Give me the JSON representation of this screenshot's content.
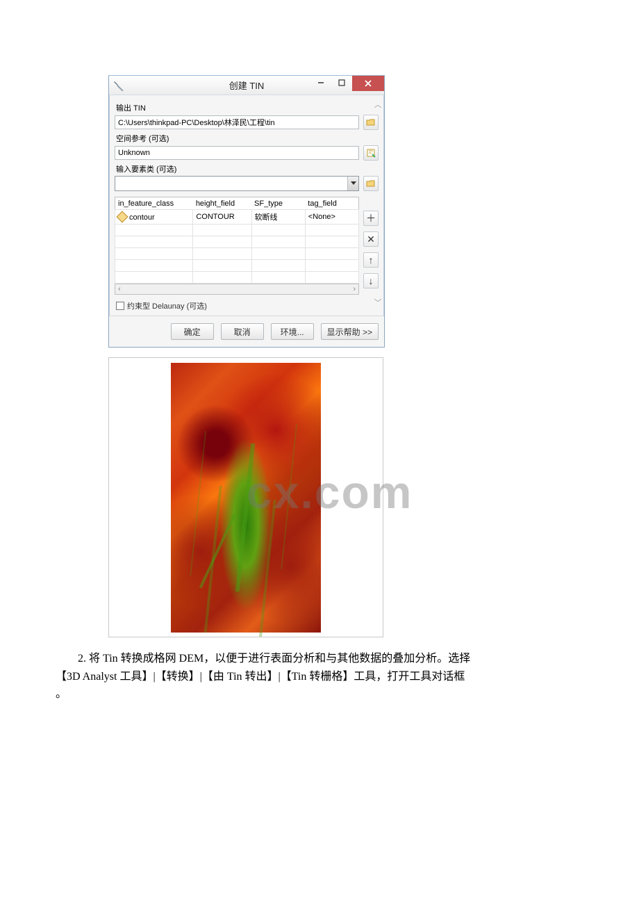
{
  "dialog": {
    "title": "创建 TIN",
    "output_label": "输出 TIN",
    "output_path": "C:\\Users\\thinkpad-PC\\Desktop\\林泽民\\工程\\tin",
    "spatial_ref_label": "空间参考 (可选)",
    "spatial_ref_value": "Unknown",
    "input_fc_label": "输入要素类 (可选)",
    "columns": {
      "c0": "in_feature_class",
      "c1": "height_field",
      "c2": "SF_type",
      "c3": "tag_field"
    },
    "row0": {
      "c0": "contour",
      "c1": "CONTOUR",
      "c2": "软断线",
      "c3": "<None>"
    },
    "checkbox_label": "约束型 Delaunay (可选)",
    "buttons": {
      "ok": "确定",
      "cancel": "取消",
      "env": "环境...",
      "help": "显示帮助 >>"
    },
    "sidebtns": {
      "add": "＋",
      "del": "✕",
      "up": "↑",
      "down": "↓"
    }
  },
  "watermark": "cx.com",
  "paragraph": {
    "line1": "2. 将 Tin 转换成格网 DEM，以便于进行表面分析和与其他数据的叠加分析。选择",
    "line2": "【3D Analyst 工具】|【转换】|【由 Tin 转出】|【Tin 转栅格】工具，打开工具对话框",
    "line3": "。"
  }
}
